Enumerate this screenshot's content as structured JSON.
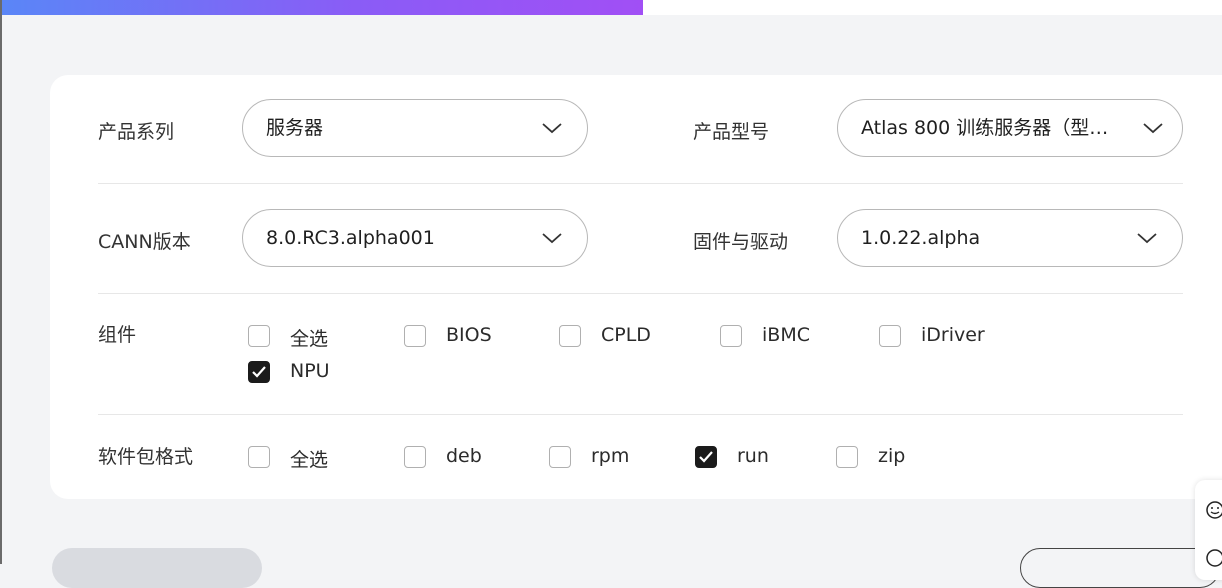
{
  "progress": {
    "fraction": 0.525,
    "color_start": "#5a86f7",
    "color_end": "#a14ff5"
  },
  "filters": {
    "product_series": {
      "label": "产品系列",
      "value": "服务器"
    },
    "product_model": {
      "label": "产品型号",
      "value": "Atlas 800 训练服务器（型…"
    },
    "cann_version": {
      "label": "CANN版本",
      "value": "8.0.RC3.alpha001"
    },
    "firmware_driver": {
      "label": "固件与驱动",
      "value": "1.0.22.alpha"
    }
  },
  "components": {
    "label": "组件",
    "options": [
      {
        "label": "全选",
        "checked": false
      },
      {
        "label": "BIOS",
        "checked": false
      },
      {
        "label": "CPLD",
        "checked": false
      },
      {
        "label": "iBMC",
        "checked": false
      },
      {
        "label": "iDriver",
        "checked": false
      },
      {
        "label": "NPU",
        "checked": true
      }
    ]
  },
  "package_format": {
    "label": "软件包格式",
    "options": [
      {
        "label": "全选",
        "checked": false
      },
      {
        "label": "deb",
        "checked": false
      },
      {
        "label": "rpm",
        "checked": false
      },
      {
        "label": "run",
        "checked": true
      },
      {
        "label": "zip",
        "checked": false
      }
    ]
  },
  "icons": {
    "dropdown": "chevron-down-icon",
    "feedback": "smiley-icon"
  },
  "colors": {
    "checked_fill": "#1b1b1b",
    "page_bg": "#f3f4f6"
  }
}
